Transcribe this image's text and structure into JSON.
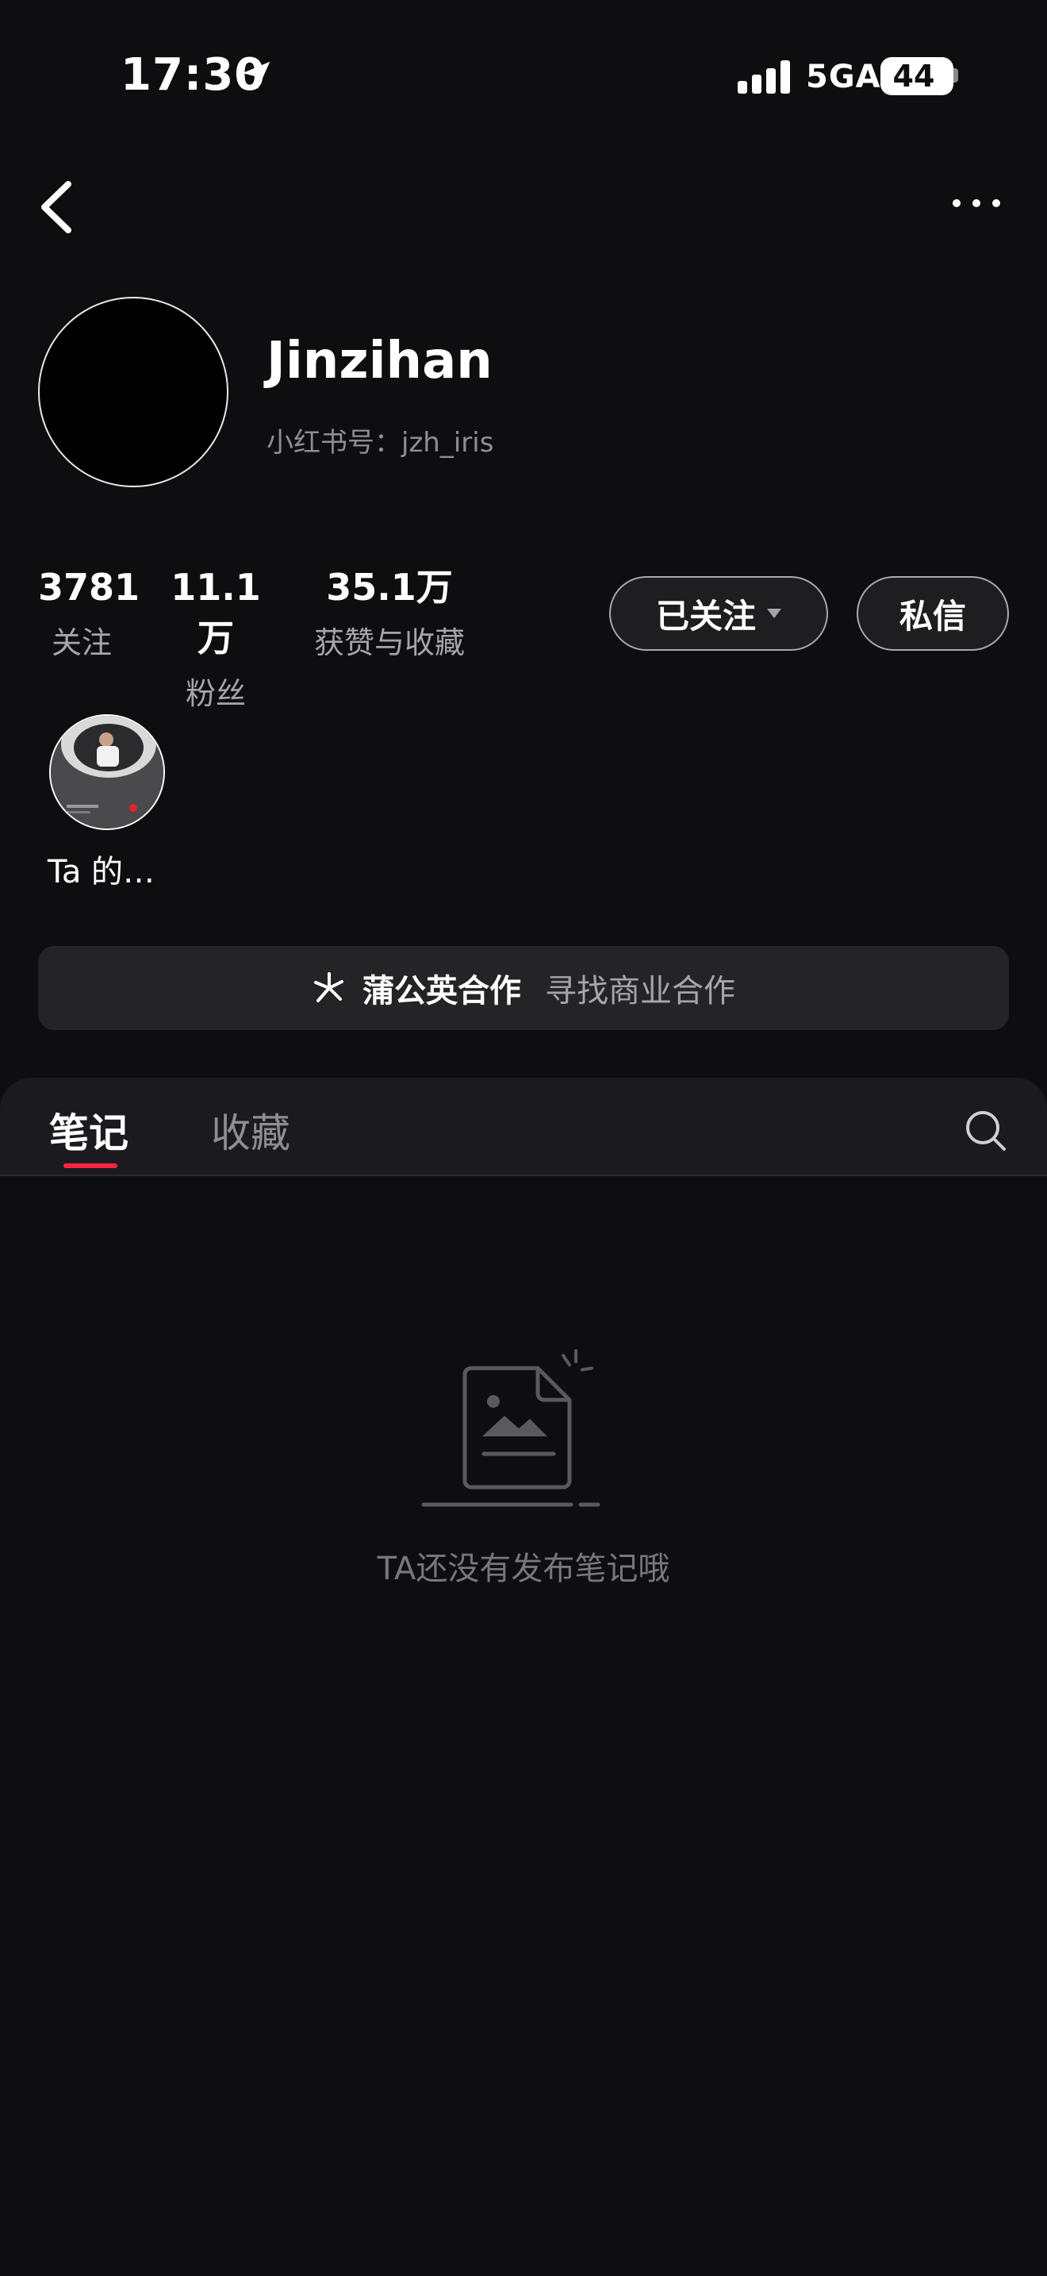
{
  "status_bar": {
    "time": "17:30",
    "network": "5GA",
    "battery": "44",
    "battery_level": 0.44
  },
  "profile": {
    "name": "Jinzihan",
    "id_label": "小红书号：jzh_iris"
  },
  "stats": {
    "following_value": "3781",
    "following_label": "关注",
    "fans_value": "11.1万",
    "fans_label": "粉丝",
    "likes_value": "35.1万",
    "likes_label": "获赞与收藏"
  },
  "actions": {
    "follow_label": "已关注",
    "message_label": "私信"
  },
  "highlight": {
    "label": "Ta 的…"
  },
  "collab": {
    "title": "蒲公英合作",
    "subtitle": "寻找商业合作"
  },
  "tabs": {
    "notes": "笔记",
    "collect": "收藏"
  },
  "empty_state": {
    "message": "TA还没有发布笔记哦"
  },
  "colors": {
    "background": "#0e0e10",
    "accent": "#ff2442",
    "secondary_text": "#a5a5aa"
  }
}
